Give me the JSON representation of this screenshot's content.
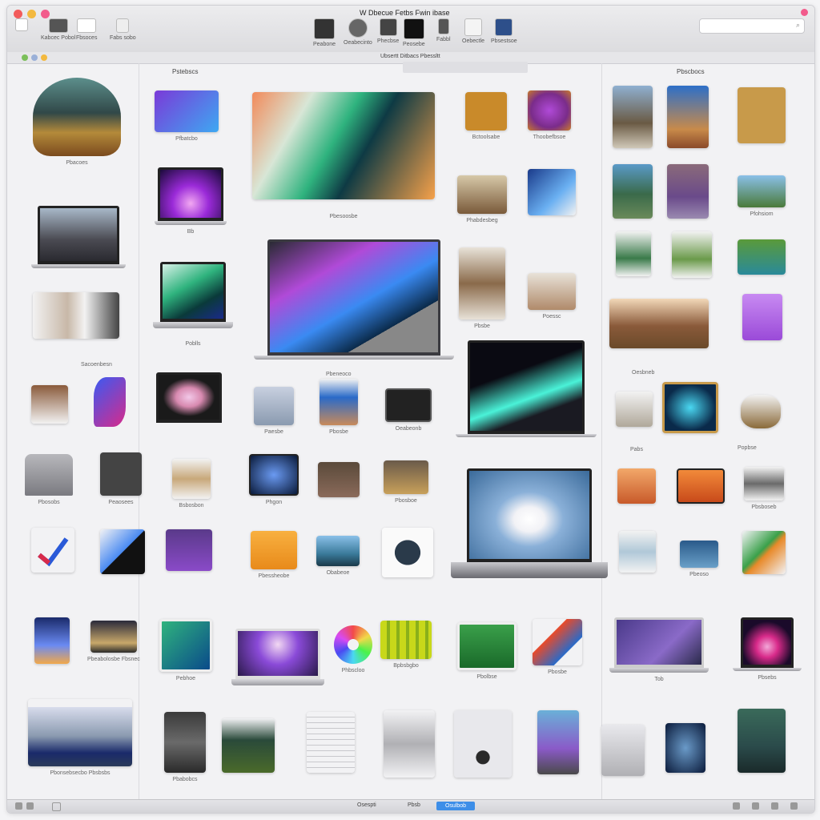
{
  "window": {
    "title": "W Dbecue Fetbs Fwin ibase",
    "path": "Ubsertt Ditbacs Pbessltt",
    "search_placeholder": "",
    "status_text": "Osespti",
    "status_text_2": "Pbsb",
    "status_selected": "Osulbob"
  },
  "toolbar": {
    "left_buttons": [
      {
        "label": ""
      },
      {
        "label": "Kabcec Pobol"
      },
      {
        "label": "Fbsoces"
      },
      {
        "label": "Fabs sobo"
      }
    ],
    "center_buttons": [
      {
        "label": "Peabone"
      },
      {
        "label": "Oeabecinto"
      },
      {
        "label": "Phecbse"
      },
      {
        "label": "Peosebe"
      },
      {
        "label": "Fabbl"
      },
      {
        "label": "Oebectle"
      },
      {
        "label": "Pbsestsoe"
      }
    ]
  },
  "columns": {
    "left_header": "Pstebscs",
    "right_header": "Pbscbocs"
  },
  "items": [
    {
      "label": "Pbacoes"
    },
    {
      "label": "Pfbatcbo"
    },
    {
      "label": "Pbesoosbe"
    },
    {
      "label": "Bctoolsabe"
    },
    {
      "label": "Thoobefbsoe"
    },
    {
      "label": "Bb"
    },
    {
      "label": "Phabdesbeg"
    },
    {
      "label": "Pfohsiom"
    },
    {
      "label": "Poblls"
    },
    {
      "label": "Pbsbe"
    },
    {
      "label": "Poessc"
    },
    {
      "label": "Sacoenbesn"
    },
    {
      "label": "Pbeneoco"
    },
    {
      "label": "Oesbneb"
    },
    {
      "label": "Paesbe"
    },
    {
      "label": "Pbosbe"
    },
    {
      "label": "Oeabeonb"
    },
    {
      "label": "Pabs"
    },
    {
      "label": "Popbse"
    },
    {
      "label": "Pbosobs"
    },
    {
      "label": "Peaosees"
    },
    {
      "label": "Bsbosbon"
    },
    {
      "label": "Phgon"
    },
    {
      "label": "Pbosboe"
    },
    {
      "label": "Pbsboseb"
    },
    {
      "label": "Pbessheobe"
    },
    {
      "label": "Obabeoe"
    },
    {
      "label": "Pbeoso"
    },
    {
      "label": "Pbeabolosbe Fbsnec"
    },
    {
      "label": "Pebhoe"
    },
    {
      "label": "Phbscloo"
    },
    {
      "label": "Bpbsbgbo"
    },
    {
      "label": "Pbolbse"
    },
    {
      "label": "Pbosbe"
    },
    {
      "label": "Tob"
    },
    {
      "label": "Pbsebs"
    },
    {
      "label": "Pbonsebsecbo Pbsbsbs"
    },
    {
      "label": "Pbabobcs"
    }
  ]
}
